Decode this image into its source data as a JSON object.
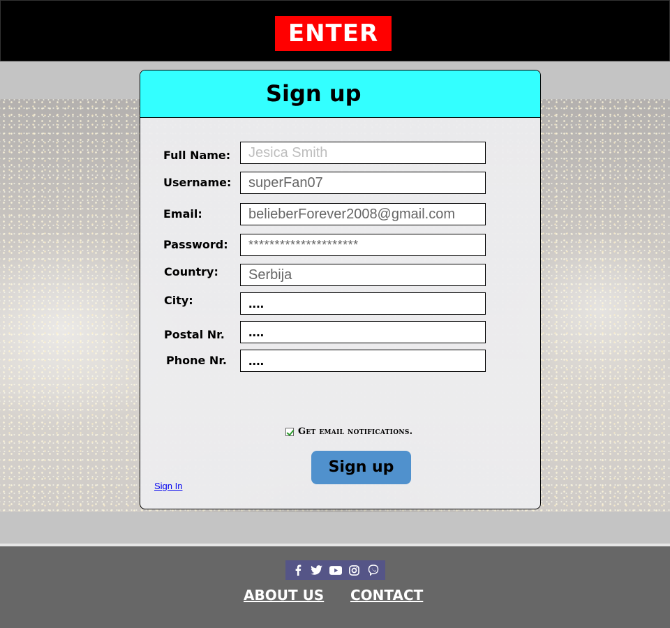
{
  "header": {
    "enter_label": "ENTER"
  },
  "form": {
    "title": "Sign up",
    "fields": [
      {
        "label": "Full Name:",
        "value": "Jesica  Smith",
        "kind": "placeholder"
      },
      {
        "label": "Username:",
        "value": "superFan07",
        "kind": "text"
      },
      {
        "label": "Email:",
        "value": "belieberForever2008@gmail.com",
        "kind": "text"
      },
      {
        "label": "Password:",
        "value": "*********************",
        "kind": "password"
      },
      {
        "label": "Country:",
        "value": "Serbija",
        "kind": "text"
      },
      {
        "label": "City:",
        "value": "....",
        "kind": "text"
      },
      {
        "label": "Postal Nr.",
        "value": "....",
        "kind": "text"
      },
      {
        "label": "Phone Nr.",
        "value": "....",
        "kind": "text"
      }
    ],
    "notifications_label": "Get email notifications.",
    "notifications_checked": true,
    "submit_label": "Sign up",
    "signin_link": "Sign In"
  },
  "footer": {
    "social_icons": [
      "facebook-icon",
      "twitter-icon",
      "youtube-icon",
      "instagram-icon",
      "viber-icon"
    ],
    "links": [
      "ABOUT US",
      "CONTACT"
    ]
  },
  "colors": {
    "header_bg": "#000000",
    "enter_button": "#ff0000",
    "card_header": "#33ffff",
    "submit_button": "#5091cd",
    "footer_bg": "#676767",
    "social_bar": "#555587"
  }
}
